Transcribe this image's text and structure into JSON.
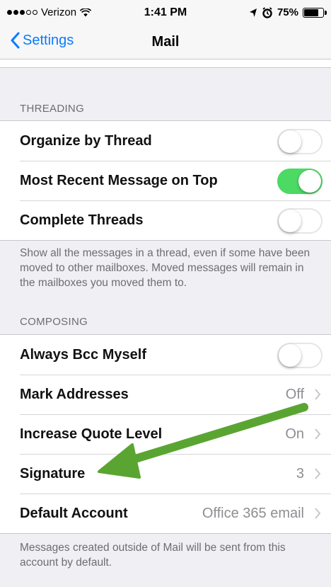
{
  "status_bar": {
    "carrier": "Verizon",
    "time": "1:41 PM",
    "battery": "75%"
  },
  "nav": {
    "back_label": "Settings",
    "title": "Mail"
  },
  "threading": {
    "header": "THREADING",
    "rows": [
      {
        "label": "Organize by Thread",
        "toggle": false
      },
      {
        "label": "Most Recent Message on Top",
        "toggle": true
      },
      {
        "label": "Complete Threads",
        "toggle": false
      }
    ],
    "footer": "Show all the messages in a thread, even if some have been moved to other mailboxes. Moved messages will remain in the mailboxes you moved them to."
  },
  "composing": {
    "header": "COMPOSING",
    "rows": [
      {
        "label": "Always Bcc Myself",
        "toggle": false
      },
      {
        "label": "Mark Addresses",
        "value": "Off"
      },
      {
        "label": "Increase Quote Level",
        "value": "On"
      },
      {
        "label": "Signature",
        "value": "3"
      },
      {
        "label": "Default Account",
        "value": "Office 365 email"
      }
    ],
    "footer": "Messages created outside of Mail will be sent from this account by default."
  },
  "colors": {
    "accent": "#0a7aff",
    "toggle_on": "#4cd964",
    "annotation_arrow": "#5aa532"
  }
}
